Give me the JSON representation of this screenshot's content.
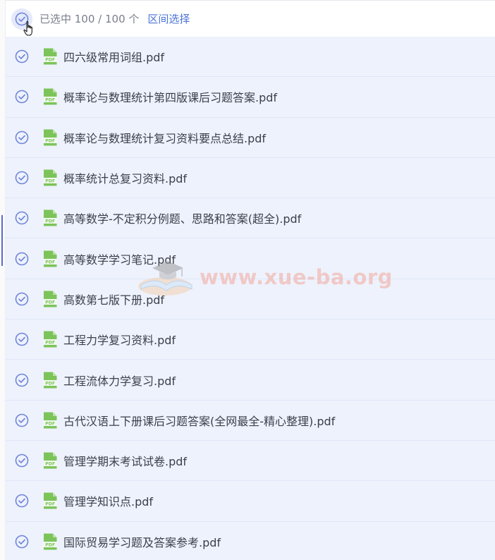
{
  "header": {
    "selection_text": "已选中 100 / 100 个",
    "range_select_label": "区间选择"
  },
  "files": [
    "四六级常用词组.pdf",
    "概率论与数理统计第四版课后习题答案.pdf",
    "概率论与数理统计复习资料要点总结.pdf",
    "概率统计总复习资料.pdf",
    "高等数学-不定积分例题、思路和答案(超全).pdf",
    "高等数学学习笔记.pdf",
    "高数第七版下册.pdf",
    "工程力学复习资料.pdf",
    "工程流体力学复习.pdf",
    "古代汉语上下册课后习题答案(全网最全-精心整理).pdf",
    "管理学期末考试试卷.pdf",
    "管理学知识点.pdf",
    "国际贸易学习题及答案参考.pdf"
  ],
  "file_icon_label": "PDF",
  "watermark": {
    "text": "www.xue-ba.org"
  },
  "colors": {
    "accent": "#4a74d6",
    "check_circle": "#6f86d9",
    "row_bg": "#eef2fd",
    "pdf_icon": "#7cc45a",
    "watermark": "#f2a89c"
  },
  "icons": {
    "checkbox": "circle-check-icon",
    "file": "pdf-file-icon",
    "cursor": "hand-pointer-icon"
  }
}
